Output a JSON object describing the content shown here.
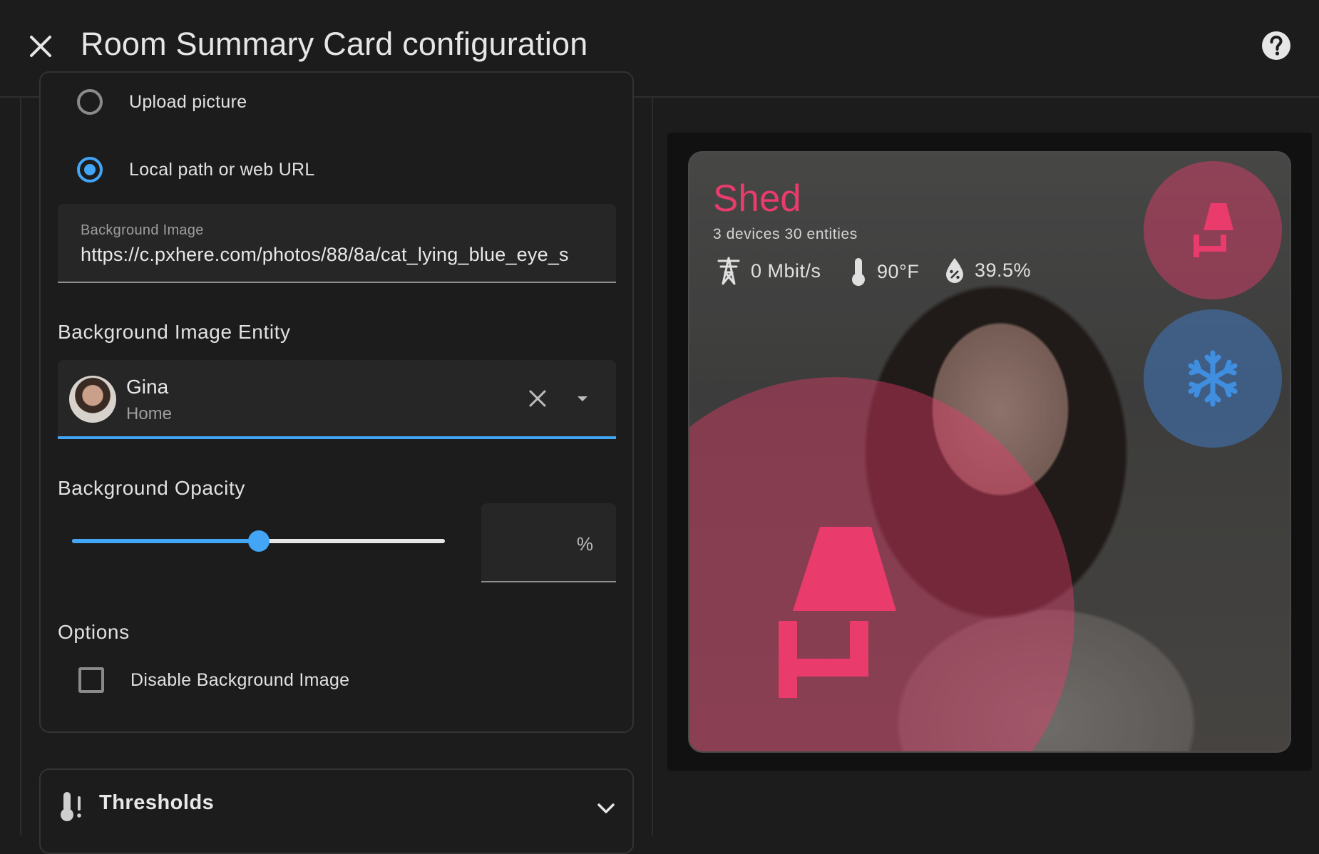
{
  "dialog": {
    "title": "Room Summary Card configuration"
  },
  "image_source": {
    "options": [
      {
        "label": "Upload picture",
        "selected": false
      },
      {
        "label": "Local path or web URL",
        "selected": true
      }
    ]
  },
  "background_image": {
    "label": "Background Image",
    "value": "https://c.pxhere.com/photos/88/8a/cat_lying_blue_eye_s"
  },
  "background_image_entity": {
    "title": "Background Image Entity",
    "name": "Gina",
    "area": "Home"
  },
  "background_opacity": {
    "title": "Background Opacity",
    "slider_value": 0.5,
    "field_value": "",
    "suffix": "%"
  },
  "options": {
    "title": "Options",
    "disable_background_label": "Disable Background Image",
    "disable_background_checked": false
  },
  "thresholds": {
    "label": "Thresholds"
  },
  "preview": {
    "room_name": "Shed",
    "stats": "3 devices 30 entities",
    "network": "0 Mbit/s",
    "temperature": "90°F",
    "humidity": "39.5%",
    "accent_color": "#e93b6c",
    "fan_color": "#3f8ee0"
  },
  "icons": [
    "close-icon",
    "help-icon",
    "clear-icon",
    "dropdown-icon",
    "thermometer-alert-icon",
    "chevron-down-icon",
    "transmission-tower-icon",
    "thermometer-icon",
    "water-percent-icon",
    "floor-lamp-icon",
    "snowflake-icon"
  ]
}
